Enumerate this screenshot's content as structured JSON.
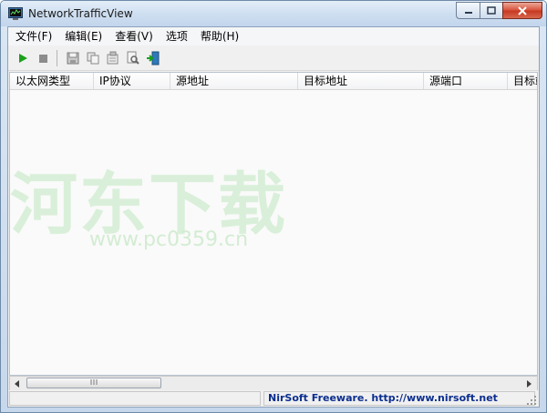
{
  "window": {
    "title": "NetworkTrafficView"
  },
  "menu": [
    {
      "label": "文件(F)"
    },
    {
      "label": "编辑(E)"
    },
    {
      "label": "查看(V)"
    },
    {
      "label": "选项"
    },
    {
      "label": "帮助(H)"
    }
  ],
  "list": {
    "columns": [
      {
        "label": "以太网类型"
      },
      {
        "label": "IP协议"
      },
      {
        "label": "源地址"
      },
      {
        "label": "目标地址"
      },
      {
        "label": "源端口"
      },
      {
        "label": "目标端口"
      }
    ]
  },
  "watermark": {
    "text": "河东下载",
    "url": "www.pc0359.cn"
  },
  "status": {
    "link_text": "NirSoft Freeware.  http://www.nirsoft.net"
  },
  "colors": {
    "play": "#1aa01a",
    "link": "#0b2e8f",
    "close": "#c4371f"
  }
}
